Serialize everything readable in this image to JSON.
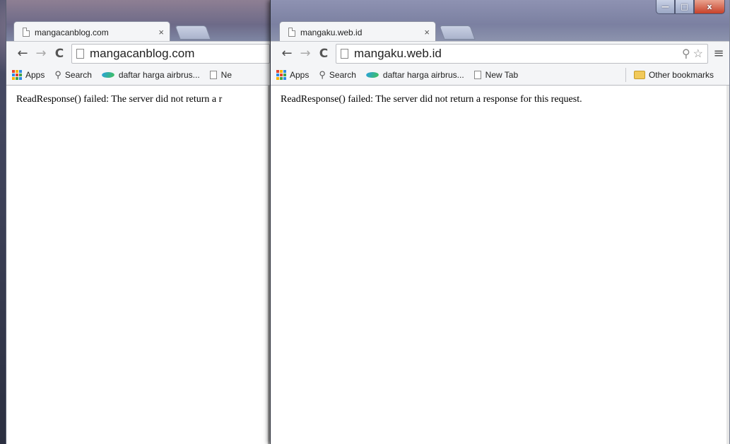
{
  "left_window": {
    "tab_title": "mangacanblog.com",
    "tab_close": "×",
    "url": "mangacanblog.com",
    "bookmarks": {
      "apps": "Apps",
      "search": "Search",
      "airbrush": "daftar harga airbrus...",
      "newtab_partial": "Ne"
    },
    "message": "ReadResponse() failed: The server did not return a r"
  },
  "right_window": {
    "tab_title": "mangaku.web.id",
    "tab_close": "×",
    "url": "mangaku.web.id",
    "bookmarks": {
      "apps": "Apps",
      "search": "Search",
      "airbrush": "daftar harga airbrus...",
      "newtab": "New Tab",
      "other": "Other bookmarks"
    },
    "message": "ReadResponse() failed: The server did not return a response for this request.",
    "caption": {
      "minimize": "—",
      "maximize": "□",
      "close": "x"
    }
  },
  "icons": {
    "back": "←",
    "forward": "→",
    "reload": "C",
    "search": "⚲",
    "zoom": "🔍",
    "star": "☆",
    "menu": "≡"
  },
  "colors": {
    "apps_grid": [
      "#e4432d",
      "#f6b400",
      "#2d8ae5",
      "#2d8ae5",
      "#e4432d",
      "#3fa34d",
      "#f6b400",
      "#3fa34d",
      "#2d8ae5"
    ]
  }
}
